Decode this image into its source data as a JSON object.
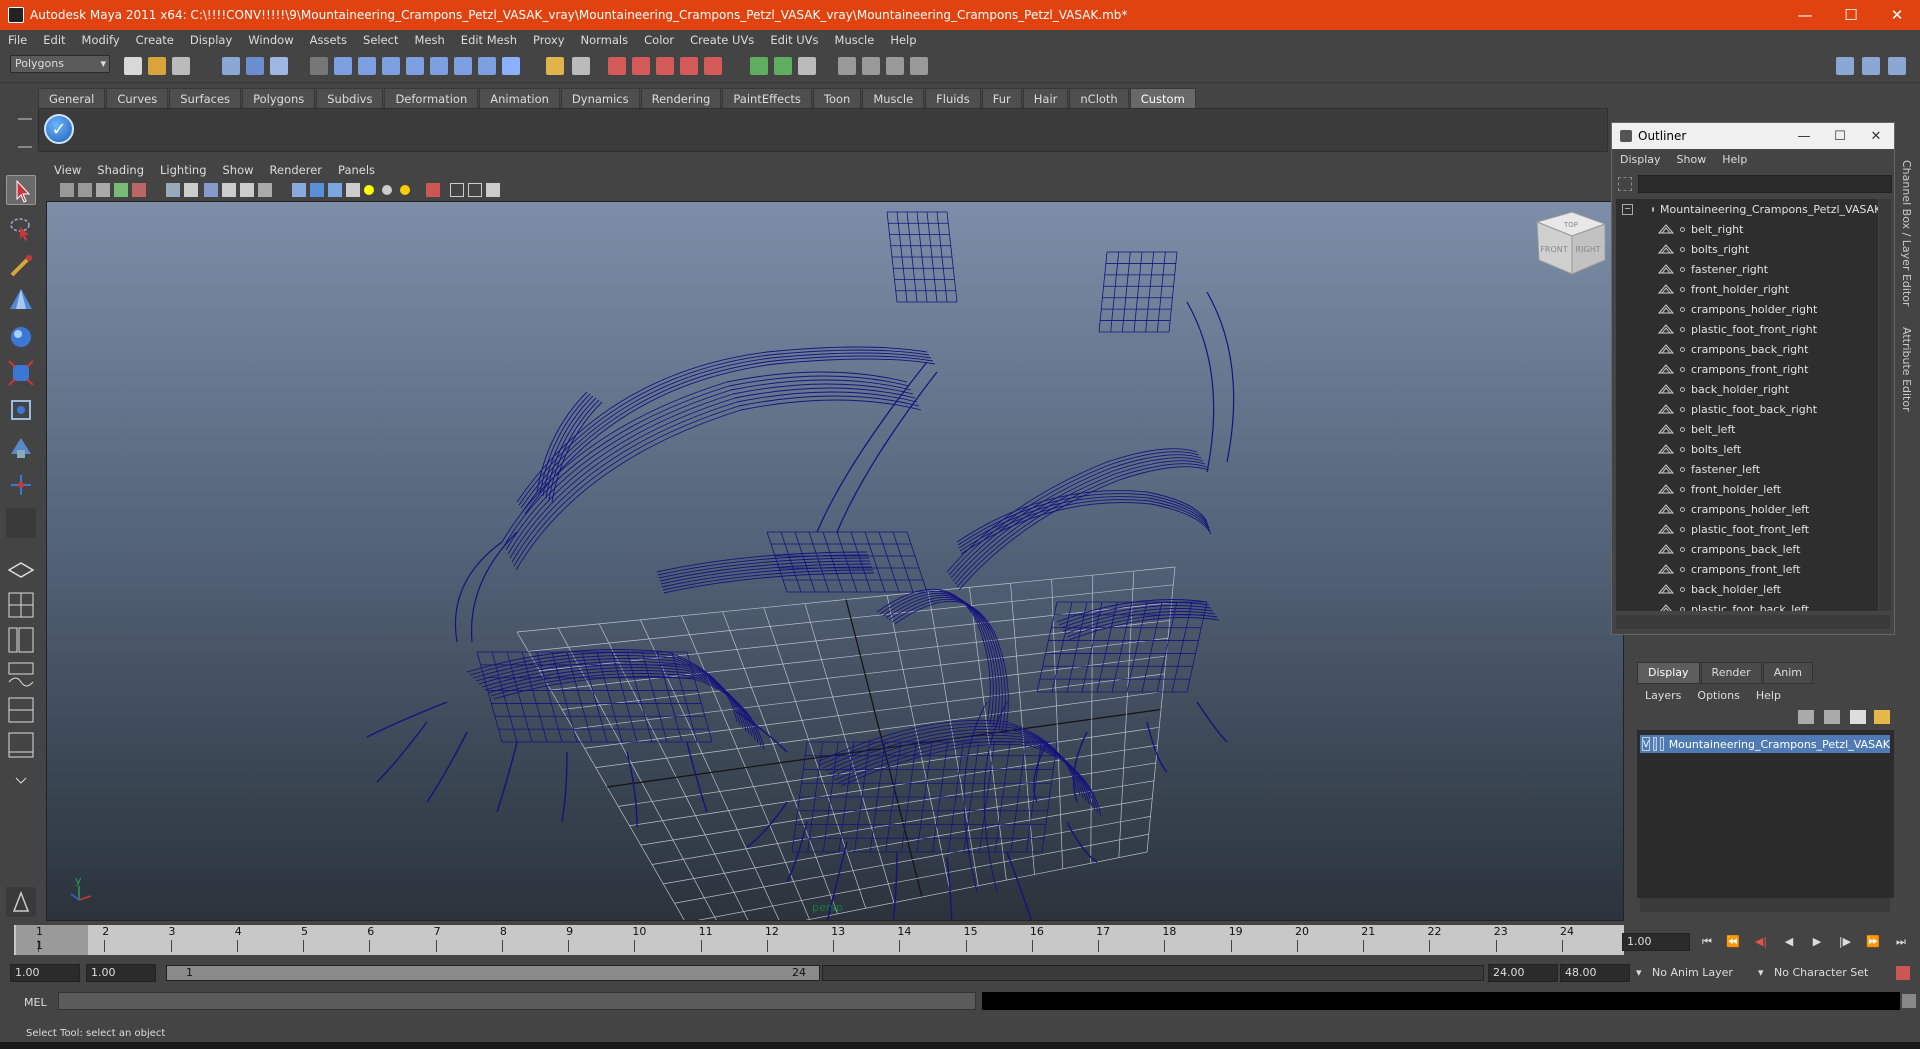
{
  "window": {
    "title": "Autodesk Maya 2011 x64: C:\\!!!!CONV!!!!!\\9\\Mountaineering_Crampons_Petzl_VASAK_vray\\Mountaineering_Crampons_Petzl_VASAK_vray\\Mountaineering_Crampons_Petzl_VASAK.mb*",
    "minimize": "—",
    "maximize": "☐",
    "close": "✕"
  },
  "menubar": [
    "File",
    "Edit",
    "Modify",
    "Create",
    "Display",
    "Window",
    "Assets",
    "Select",
    "Mesh",
    "Edit Mesh",
    "Proxy",
    "Normals",
    "Color",
    "Create UVs",
    "Edit UVs",
    "Muscle",
    "Help"
  ],
  "status": {
    "mode": "Polygons"
  },
  "shelf": {
    "tabs": [
      "General",
      "Curves",
      "Surfaces",
      "Polygons",
      "Subdivs",
      "Deformation",
      "Animation",
      "Dynamics",
      "Rendering",
      "PaintEffects",
      "Toon",
      "Muscle",
      "Fluids",
      "Fur",
      "Hair",
      "nCloth",
      "Custom"
    ],
    "active": "Custom",
    "check_glyph": "✓"
  },
  "viewport": {
    "menu": [
      "View",
      "Shading",
      "Lighting",
      "Show",
      "Renderer",
      "Panels"
    ],
    "camera_label": "persp",
    "cube_top": "TOP",
    "cube_front": "FRONT",
    "cube_right": "RIGHT",
    "axis_y": "y",
    "grid_color": "#b9c1cc",
    "wire_color": "#14137e"
  },
  "outliner": {
    "title": "Outliner",
    "menu": [
      "Display",
      "Show",
      "Help"
    ],
    "root": "Mountaineering_Crampons_Petzl_VASAK",
    "items": [
      "belt_right",
      "bolts_right",
      "fastener_right",
      "front_holder_right",
      "crampons_holder_right",
      "plastic_foot_front_right",
      "crampons_back_right",
      "crampons_front_right",
      "back_holder_right",
      "plastic_foot_back_right",
      "belt_left",
      "bolts_left",
      "fastener_left",
      "front_holder_left",
      "crampons_holder_left",
      "plastic_foot_front_left",
      "crampons_back_left",
      "crampons_front_left",
      "back_holder_left",
      "plastic_foot_back_left"
    ]
  },
  "side_tabs": [
    "Channel Box / Layer Editor",
    "Attribute Editor"
  ],
  "layers": {
    "tabs": [
      "Display",
      "Render",
      "Anim"
    ],
    "active": "Display",
    "menu": [
      "Layers",
      "Options",
      "Help"
    ],
    "visibility": "V",
    "row_name": "Mountaineering_Crampons_Petzl_VASAK"
  },
  "timeline": {
    "ticks": [
      "1",
      "2",
      "3",
      "4",
      "5",
      "6",
      "7",
      "8",
      "9",
      "10",
      "11",
      "12",
      "13",
      "14",
      "15",
      "16",
      "17",
      "18",
      "19",
      "20",
      "21",
      "22",
      "23",
      "24"
    ],
    "current_frame": "1",
    "current_time_field": "1.00",
    "play_controls": [
      "⏮",
      "⏪",
      "◀|",
      "◀",
      "▶",
      "|▶",
      "⏩",
      "⏭"
    ]
  },
  "range": {
    "start_time": "1.00",
    "playback_start": "1.00",
    "slider_start": "1",
    "slider_end": "24",
    "playback_end": "24.00",
    "end_time": "48.00",
    "anim_layer": "No Anim Layer",
    "character_set": "No Character Set"
  },
  "command": {
    "label": "MEL"
  },
  "help_line": "Select Tool: select an object"
}
